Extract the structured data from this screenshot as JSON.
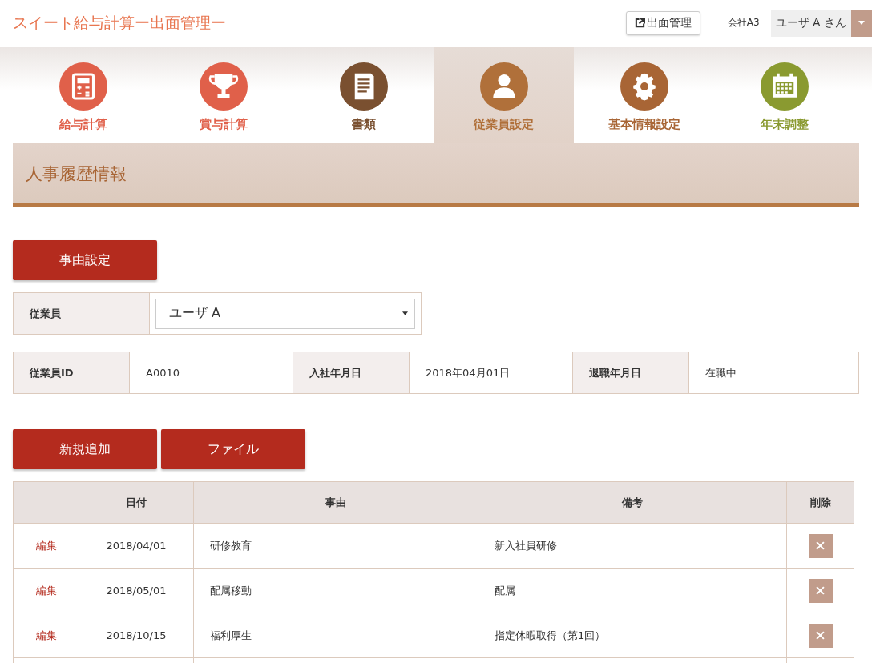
{
  "header": {
    "title": "スイート給与計算ー出面管理ー",
    "link_button": "出面管理",
    "company": "会社A3",
    "user": "ユーザ A さん"
  },
  "tabs": [
    {
      "label": "給与計算",
      "selected": false,
      "color": "#e0604a"
    },
    {
      "label": "賞与計算",
      "selected": false,
      "color": "#e0604a"
    },
    {
      "label": "書類",
      "selected": false,
      "color": "#7a5030"
    },
    {
      "label": "従業員設定",
      "selected": true,
      "color": "#b0703a"
    },
    {
      "label": "基本情報設定",
      "selected": false,
      "color": "#a86535"
    },
    {
      "label": "年末調整",
      "selected": false,
      "color": "#8a9a30"
    }
  ],
  "page_title": "人事履歴情報",
  "reason_button": "事由設定",
  "employee_select": {
    "label": "従業員",
    "value": "ユーザ A"
  },
  "info": [
    {
      "label": "従業員ID",
      "value": "A0010"
    },
    {
      "label": "入社年月日",
      "value": "2018年04月01日"
    },
    {
      "label": "退職年月日",
      "value": "在職中"
    }
  ],
  "buttons": [
    "新規追加",
    "ファイル"
  ],
  "table": {
    "columns": [
      "",
      "日付",
      "事由",
      "備考",
      "削除"
    ],
    "rows": [
      {
        "edit": "編集",
        "date": "2018/04/01",
        "reason": "研修教育",
        "note": "新入社員研修"
      },
      {
        "edit": "編集",
        "date": "2018/05/01",
        "reason": "配属移動",
        "note": "配属"
      },
      {
        "edit": "編集",
        "date": "2018/10/15",
        "reason": "福利厚生",
        "note": "指定休暇取得（第1回）"
      }
    ]
  }
}
